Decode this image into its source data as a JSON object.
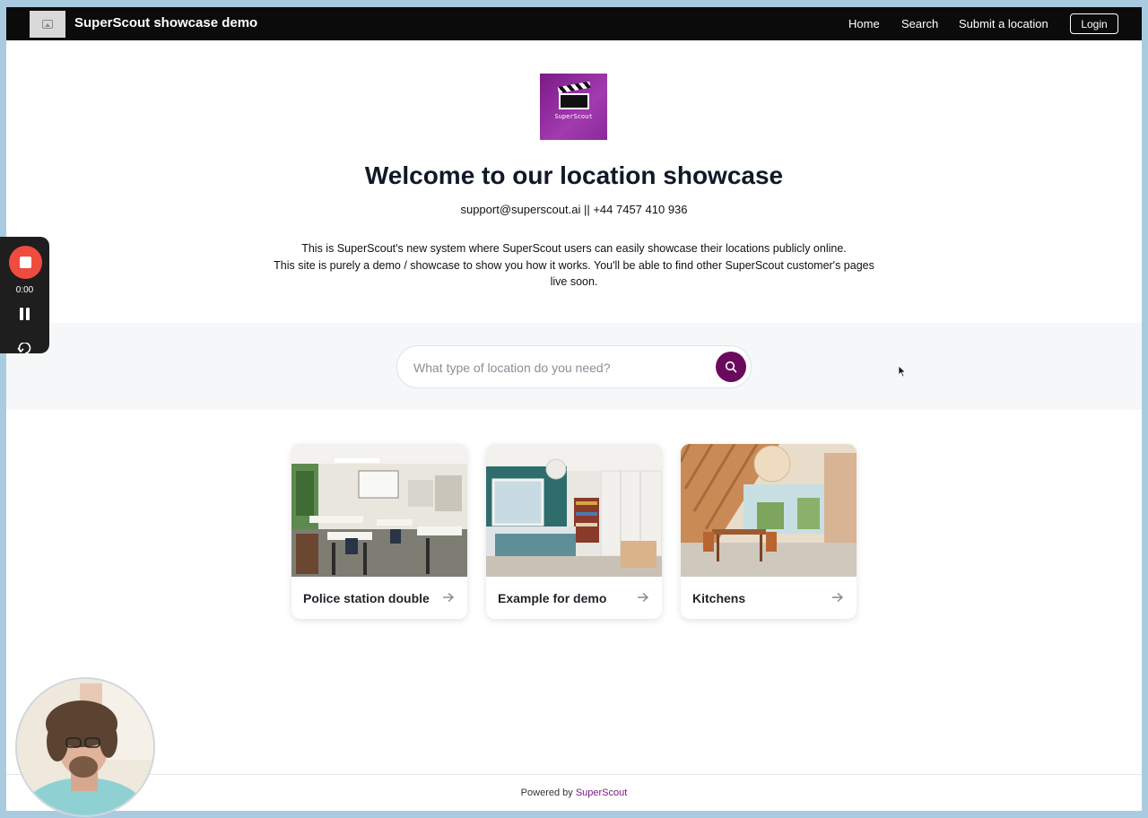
{
  "navbar": {
    "brand_title": "SuperScout showcase demo",
    "links": [
      "Home",
      "Search",
      "Submit a location"
    ],
    "login_label": "Login"
  },
  "hero": {
    "logo_text": "SuperScout",
    "title": "Welcome to our location showcase",
    "contact": "support@superscout.ai || +44 7457 410 936",
    "intro_lines": [
      "This is SuperScout's new system where SuperScout users can easily showcase their locations publicly online.",
      "This site is purely a demo / showcase to show you how it works. You'll be able to find other SuperScout customer's pages",
      "live soon."
    ]
  },
  "search": {
    "placeholder": "What type of location do you need?",
    "value": "",
    "accent_color": "#6b0a5c"
  },
  "cards": [
    {
      "title": "Police station double",
      "image": "classroom-photo"
    },
    {
      "title": "Example for demo",
      "image": "bedroom-photo"
    },
    {
      "title": "Kitchens",
      "image": "dining-room-photo"
    }
  ],
  "footer": {
    "prefix": "Powered by",
    "brand": "SuperScout"
  },
  "recorder": {
    "time": "0:00",
    "stop_color": "#ef4b3e"
  }
}
